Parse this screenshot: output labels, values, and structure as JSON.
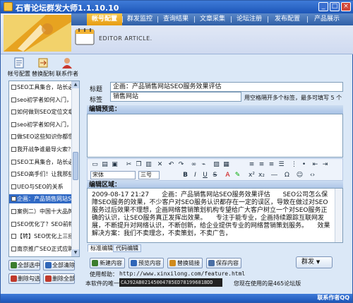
{
  "window": {
    "title": "石青论坛群发大师1.1.10.10",
    "min_label": "_",
    "max_label": "□",
    "close_label": "×"
  },
  "nav": {
    "tabs": [
      {
        "label": "帐号配置",
        "active": true
      },
      {
        "label": "群发监控",
        "active": false
      },
      {
        "label": "查询结果",
        "active": false
      },
      {
        "label": "文章采集",
        "active": false
      },
      {
        "label": "论坛注册",
        "active": false
      },
      {
        "label": "发布配置",
        "active": false
      },
      {
        "label": "产品展示",
        "active": false
      }
    ]
  },
  "banner": {
    "subtitle": "EDITOR ARTICLE."
  },
  "left_tools": [
    {
      "label": "帐号配置",
      "icon": "account-config-icon"
    },
    {
      "label": "替换配制",
      "icon": "replace-config-icon"
    },
    {
      "label": "联系作者",
      "icon": "contact-author-icon"
    }
  ],
  "article_list": [
    {
      "title": "SEO工具集合，站长必备",
      "selected": false
    },
    {
      "title": "seo初学者如何入门，网站",
      "selected": false
    },
    {
      "title": "如何做到SEO定位文章模板",
      "selected": false
    },
    {
      "title": "seo初学者如何入门，网站",
      "selected": false
    },
    {
      "title": "做SEO这些知识你都懂了吗",
      "selected": false
    },
    {
      "title": "我开战争谁最导火索？",
      "selected": false
    },
    {
      "title": "SEO工具集合，站长必备",
      "selected": false
    },
    {
      "title": "SEO高手们！让我那些",
      "selected": false
    },
    {
      "title": "UEO与SEO的关系",
      "selected": false
    },
    {
      "title": "企画：产品销售网站SEO服务效果评估",
      "selected": true
    },
    {
      "title": "案例二）中国十大品牌",
      "selected": false
    },
    {
      "title": "SEO优化了？SEO前帽子",
      "selected": false
    },
    {
      "title": "【转】SEO优化上三招让你",
      "selected": false
    },
    {
      "title": "南京推广SEO正式应聘",
      "selected": false
    }
  ],
  "left_buttons": {
    "select_all": "全部选中",
    "clear_all": "全部清除",
    "delete_checked": "删除勾选",
    "delete_all": "删除全部"
  },
  "form": {
    "title_label": "标题",
    "title_value": "企画：产品销售网站SEO服务效果评估",
    "tags_label": "标签",
    "tags_value": "销售网站",
    "tags_hint": "用空格隔开多个标签，最多可填写 5 个"
  },
  "preview": {
    "header": "编辑预览："
  },
  "toolbar": {
    "font_family": "宋体",
    "font_size": "三号",
    "buttons": [
      "bold",
      "italic",
      "underline",
      "strikethrough",
      "font-color",
      "highlight",
      "align-left",
      "align-center",
      "align-right",
      "justify",
      "ordered-list",
      "unordered-list",
      "outdent",
      "indent",
      "link",
      "unlink",
      "image",
      "table",
      "undo",
      "redo",
      "cut",
      "copy",
      "paste",
      "clear-format"
    ]
  },
  "editor": {
    "header": "编辑区域：",
    "content": "2009-08-17 21:27　　企画：产品销售网站SEO服务效果评估　　SEO公司怎么保障SEO服务的效果，不少客户对SEO服务认识都存在一定的误区，导致在做过对SEO服务过后效果不理想，企画网络营销策划机构专望给广大客户树立一个对SEO服务正确的认识，让SEO服务真正发挥出效果。　　专注于能专业，企画持续跟踪互联网发展，不断提升对网络认识，不断创新，给企业提供专业的网络营销策划服务。　　效果解决方案：我们不卖理念，不卖策划，不卖广告，",
    "mode_tabs": [
      {
        "label": "标准编辑",
        "active": true
      },
      {
        "label": "代码编辑",
        "active": false
      }
    ]
  },
  "actions": {
    "new": "新建内容",
    "preview": "预览内容",
    "replace": "替换链接",
    "save": "保存内容",
    "send": "群发"
  },
  "footer": {
    "address_label": "使用帮助：",
    "address_value": "http://www.xinxilong.com/feature.html",
    "machine_label": "本软件的唯一号：",
    "machine_code": "CAJ92AB02145004785ED78199681BDD",
    "version_note": "您现在使用的是465论坛版"
  },
  "status": {
    "contact": "联系作者QQ"
  }
}
